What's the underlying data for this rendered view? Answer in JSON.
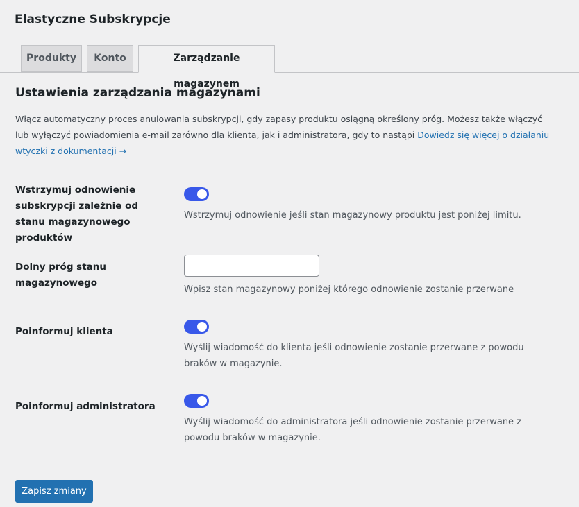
{
  "page_title": "Elastyczne Subskrypcje",
  "tabs": [
    {
      "label": "Produkty",
      "active": false
    },
    {
      "label": "Konto",
      "active": false
    },
    {
      "label": "Zarządzanie magazynem",
      "active": true
    }
  ],
  "section": {
    "title": "Ustawienia zarządzania magazynami",
    "intro_text": "Włącz automatyczny proces anulowania subskrypcji, gdy zapasy produktu osiągną określony próg. Możesz także włączyć lub wyłączyć powiadomienia e-mail zarówno dla klienta, jak i administratora, gdy to nastąpi ",
    "doc_link": "Dowiedz się więcej o działaniu wtyczki z dokumentacji →"
  },
  "settings": {
    "pause_renewal": {
      "label": "Wstrzymuj odnowienie subskrypcji zależnie od stanu magazynowego produktów",
      "enabled": true,
      "description": "Wstrzymuj odnowienie jeśli stan magazynowy produktu jest poniżej limitu."
    },
    "stock_threshold": {
      "label": "Dolny próg stanu magazynowego",
      "value": "",
      "placeholder": "",
      "description": "Wpisz stan magazynowy poniżej którego odnowienie zostanie przerwane"
    },
    "notify_customer": {
      "label": "Poinformuj klienta",
      "enabled": true,
      "description": "Wyślij wiadomość do klienta jeśli odnowienie zostanie przerwane z powodu braków w magazynie."
    },
    "notify_admin": {
      "label": "Poinformuj administratora",
      "enabled": true,
      "description": "Wyślij wiadomość do administratora jeśli odnowienie zostanie przerwane z powodu braków w magazynie."
    }
  },
  "save_button": "Zapisz zmiany",
  "colors": {
    "accent": "#3858e9",
    "button": "#2271b1",
    "background": "#f0f0f1"
  }
}
